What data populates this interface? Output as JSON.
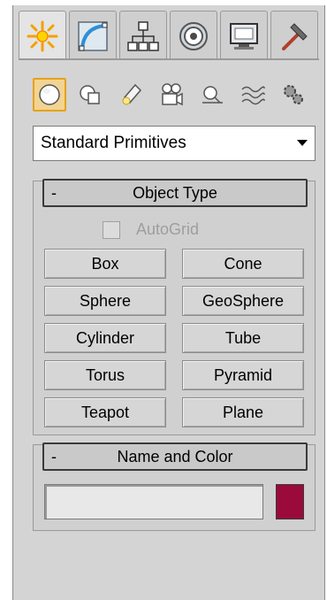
{
  "command_tabs": [
    {
      "icon": "create-sun-icon",
      "active": true
    },
    {
      "icon": "modify-curve-icon"
    },
    {
      "icon": "hierarchy-icon"
    },
    {
      "icon": "motion-wheel-icon"
    },
    {
      "icon": "display-monitor-icon"
    },
    {
      "icon": "utilities-hammer-icon"
    }
  ],
  "sub_categories": [
    {
      "icon": "geometry-sphere-icon",
      "active": true
    },
    {
      "icon": "shapes-icon"
    },
    {
      "icon": "lights-icon"
    },
    {
      "icon": "cameras-icon"
    },
    {
      "icon": "helpers-icon"
    },
    {
      "icon": "space-warps-icon"
    },
    {
      "icon": "systems-icon"
    }
  ],
  "dropdown": {
    "value": "Standard Primitives"
  },
  "object_type": {
    "collapse": "-",
    "title": "Object Type",
    "autogrid_label": "AutoGrid",
    "buttons": [
      "Box",
      "Cone",
      "Sphere",
      "GeoSphere",
      "Cylinder",
      "Tube",
      "Torus",
      "Pyramid",
      "Teapot",
      "Plane"
    ]
  },
  "name_and_color": {
    "collapse": "-",
    "title": "Name and Color",
    "name_value": "",
    "color": "#9a0b3c"
  },
  "colors": {
    "active_highlight": "#f2d492",
    "active_border": "#e6a21c",
    "panel_bg": "#d4d4d4"
  }
}
